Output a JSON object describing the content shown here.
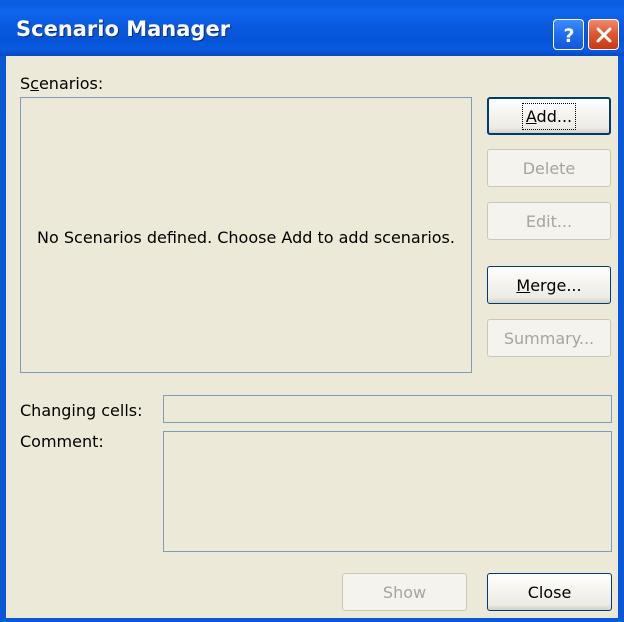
{
  "window": {
    "title": "Scenario Manager",
    "help_symbol": "?",
    "colors": {
      "titlebar": "#0a5ce0",
      "dialog_bg": "#ece9d8",
      "close_button": "#e0542d"
    }
  },
  "scenarios": {
    "label_pre": "S",
    "label_accel": "c",
    "label_post": "enarios:",
    "empty_message": "No Scenarios defined. Choose Add to add scenarios."
  },
  "buttons": {
    "add": {
      "accel": "A",
      "rest": "dd...",
      "enabled": true,
      "focused": true
    },
    "delete": {
      "label": "Delete",
      "enabled": false
    },
    "edit": {
      "label": "Edit...",
      "enabled": false
    },
    "merge": {
      "accel": "M",
      "rest": "erge...",
      "enabled": true
    },
    "summary": {
      "label": "Summary...",
      "enabled": false
    },
    "show": {
      "label": "Show",
      "enabled": false
    },
    "close": {
      "label": "Close",
      "enabled": true
    }
  },
  "fields": {
    "changing_cells_label": "Changing cells:",
    "changing_cells_value": "",
    "comment_label": "Comment:",
    "comment_value": ""
  },
  "icons": [
    "help-icon",
    "close-icon"
  ]
}
